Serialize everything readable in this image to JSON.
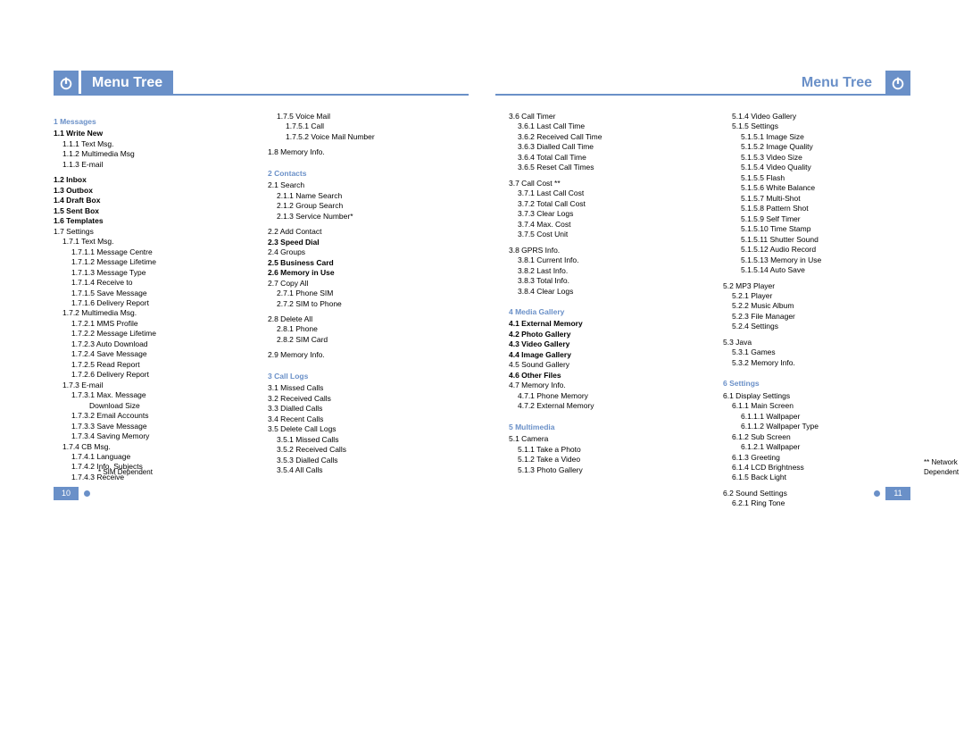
{
  "title": "Menu Tree",
  "page_left_num": "10",
  "page_right_num": "11",
  "footnote_left": "* SIM Dependent",
  "footnote_right": "** Network Dependent",
  "col1": [
    {
      "t": "1 Messages",
      "head": true
    },
    {
      "t": "1.1 Write New",
      "bold": true,
      "l": 1
    },
    {
      "t": "1.1.1 Text Msg.",
      "l": 2
    },
    {
      "t": "1.1.2 Multimedia Msg",
      "l": 2
    },
    {
      "t": "1.1.3 E-mail",
      "l": 2
    },
    {
      "sp": true
    },
    {
      "t": "1.2 Inbox",
      "bold": true,
      "l": 1
    },
    {
      "t": "1.3 Outbox",
      "bold": true,
      "l": 1
    },
    {
      "t": "1.4 Draft Box",
      "bold": true,
      "l": 1
    },
    {
      "t": "1.5 Sent Box",
      "bold": true,
      "l": 1
    },
    {
      "t": "1.6 Templates",
      "bold": true,
      "l": 1
    },
    {
      "t": "1.7 Settings",
      "l": 1
    },
    {
      "t": "1.7.1 Text Msg.",
      "l": 2
    },
    {
      "t": "1.7.1.1 Message Centre",
      "l": 3
    },
    {
      "t": "1.7.1.2 Message Lifetime",
      "l": 3
    },
    {
      "t": "1.7.1.3 Message Type",
      "l": 3
    },
    {
      "t": "1.7.1.4 Receive to",
      "l": 3
    },
    {
      "t": "1.7.1.5 Save Message",
      "l": 3
    },
    {
      "t": "1.7.1.6 Delivery Report",
      "l": 3
    },
    {
      "t": "1.7.2 Multimedia Msg.",
      "l": 2
    },
    {
      "t": "1.7.2.1 MMS Profile",
      "l": 3
    },
    {
      "t": "1.7.2.2 Message Lifetime",
      "l": 3
    },
    {
      "t": "1.7.2.3 Auto Download",
      "l": 3
    },
    {
      "t": "1.7.2.4 Save Message",
      "l": 3
    },
    {
      "t": "1.7.2.5 Read Report",
      "l": 3
    },
    {
      "t": "1.7.2.6 Delivery Report",
      "l": 3
    },
    {
      "t": "1.7.3 E-mail",
      "l": 2
    },
    {
      "t": "1.7.3.1 Max. Message",
      "l": 3
    },
    {
      "t": "Download Size",
      "l": 5
    },
    {
      "t": "1.7.3.2 Email Accounts",
      "l": 3
    },
    {
      "t": "1.7.3.3 Save Message",
      "l": 3
    },
    {
      "t": "1.7.3.4 Saving Memory",
      "l": 3
    },
    {
      "t": "1.7.4 CB Msg.",
      "l": 2
    },
    {
      "t": "1.7.4.1 Language",
      "l": 3
    },
    {
      "t": "1.7.4.2 Info. Subjects",
      "l": 3
    },
    {
      "t": "1.7.4.3 Receive",
      "l": 3
    }
  ],
  "col2": [
    {
      "t": "1.7.5 Voice Mail",
      "l": 2
    },
    {
      "t": "1.7.5.1 Call",
      "l": 3
    },
    {
      "t": "1.7.5.2 Voice Mail Number",
      "l": 3
    },
    {
      "sp": true
    },
    {
      "t": "1.8 Memory Info.",
      "l": 1
    },
    {
      "sp": true
    },
    {
      "t": "2 Contacts",
      "head": true
    },
    {
      "t": "2.1 Search",
      "l": 1
    },
    {
      "t": "2.1.1 Name Search",
      "l": 2
    },
    {
      "t": "2.1.2 Group Search",
      "l": 2
    },
    {
      "t": "2.1.3 Service Number*",
      "l": 2
    },
    {
      "sp": true
    },
    {
      "t": "2.2 Add Contact",
      "l": 1
    },
    {
      "t": "2.3 Speed Dial",
      "bold": true,
      "l": 1
    },
    {
      "t": "2.4 Groups",
      "l": 1
    },
    {
      "t": "2.5 Business Card",
      "bold": true,
      "l": 1
    },
    {
      "t": "2.6 Memory in Use",
      "bold": true,
      "l": 1
    },
    {
      "t": "2.7 Copy All",
      "l": 1
    },
    {
      "t": "2.7.1 Phone SIM",
      "l": 2
    },
    {
      "t": "2.7.2 SIM to Phone",
      "l": 2
    },
    {
      "sp": true
    },
    {
      "t": "2.8 Delete All",
      "l": 1
    },
    {
      "t": "2.8.1 Phone",
      "l": 2
    },
    {
      "t": "2.8.2 SIM Card",
      "l": 2
    },
    {
      "sp": true
    },
    {
      "t": "2.9 Memory Info.",
      "l": 1
    },
    {
      "sp": true
    },
    {
      "t": "3 Call Logs",
      "head": true
    },
    {
      "t": "3.1 Missed Calls",
      "l": 1
    },
    {
      "t": "3.2 Received Calls",
      "l": 1
    },
    {
      "t": "3.3 Dialled Calls",
      "l": 1
    },
    {
      "t": "3.4 Recent Calls",
      "l": 1
    },
    {
      "t": "3.5 Delete Call Logs",
      "l": 1
    },
    {
      "t": "3.5.1 Missed Calls",
      "l": 2
    },
    {
      "t": "3.5.2 Received Calls",
      "l": 2
    },
    {
      "t": "3.5.3 Dialled Calls",
      "l": 2
    },
    {
      "t": "3.5.4 All Calls",
      "l": 2
    }
  ],
  "col3": [
    {
      "t": "3.6 Call Timer",
      "l": 1
    },
    {
      "t": "3.6.1 Last Call Time",
      "l": 2
    },
    {
      "t": "3.6.2 Received Call Time",
      "l": 2
    },
    {
      "t": "3.6.3 Dialled Call Time",
      "l": 2
    },
    {
      "t": "3.6.4 Total Call Time",
      "l": 2
    },
    {
      "t": "3.6.5 Reset Call Times",
      "l": 2
    },
    {
      "sp": true
    },
    {
      "t": "3.7 Call Cost **",
      "l": 1
    },
    {
      "t": "3.7.1 Last Call Cost",
      "l": 2
    },
    {
      "t": "3.7.2 Total Call Cost",
      "l": 2
    },
    {
      "t": "3.7.3 Clear Logs",
      "l": 2
    },
    {
      "t": "3.7.4 Max. Cost",
      "l": 2
    },
    {
      "t": "3.7.5 Cost Unit",
      "l": 2
    },
    {
      "sp": true
    },
    {
      "t": "3.8 GPRS Info.",
      "l": 1
    },
    {
      "t": "3.8.1 Current Info.",
      "l": 2
    },
    {
      "t": "3.8.2 Last Info.",
      "l": 2
    },
    {
      "t": "3.8.3 Total Info.",
      "l": 2
    },
    {
      "t": "3.8.4 Clear Logs",
      "l": 2
    },
    {
      "sp": true
    },
    {
      "t": "4 Media Gallery",
      "head": true
    },
    {
      "t": "4.1 External Memory",
      "bold": true,
      "l": 1
    },
    {
      "t": "4.2 Photo Gallery",
      "bold": true,
      "l": 1
    },
    {
      "t": "4.3 Video Gallery",
      "bold": true,
      "l": 1
    },
    {
      "t": "4.4 Image Gallery",
      "bold": true,
      "l": 1
    },
    {
      "t": "4.5 Sound Gallery",
      "l": 1
    },
    {
      "t": "4.6 Other Files",
      "bold": true,
      "l": 1
    },
    {
      "t": "4.7 Memory Info.",
      "l": 1
    },
    {
      "t": "4.7.1 Phone Memory",
      "l": 2
    },
    {
      "t": "4.7.2 External Memory",
      "l": 2
    },
    {
      "sp": true
    },
    {
      "t": "5 Multimedia",
      "head": true
    },
    {
      "t": "5.1 Camera",
      "l": 1
    },
    {
      "t": "5.1.1 Take a Photo",
      "l": 2
    },
    {
      "t": "5.1.2 Take a Video",
      "l": 2
    },
    {
      "t": "5.1.3 Photo Gallery",
      "l": 2
    }
  ],
  "col4": [
    {
      "t": "5.1.4 Video Gallery",
      "l": 2
    },
    {
      "t": "5.1.5 Settings",
      "l": 2
    },
    {
      "t": "5.1.5.1 Image Size",
      "l": 3
    },
    {
      "t": "5.1.5.2 Image Quality",
      "l": 3
    },
    {
      "t": "5.1.5.3 Video Size",
      "l": 3
    },
    {
      "t": "5.1.5.4 Video Quality",
      "l": 3
    },
    {
      "t": "5.1.5.5 Flash",
      "l": 3
    },
    {
      "t": "5.1.5.6 White Balance",
      "l": 3
    },
    {
      "t": "5.1.5.7 Multi-Shot",
      "l": 3
    },
    {
      "t": "5.1.5.8 Pattern Shot",
      "l": 3
    },
    {
      "t": "5.1.5.9 Self Timer",
      "l": 3
    },
    {
      "t": "5.1.5.10 Time Stamp",
      "l": 3
    },
    {
      "t": "5.1.5.11 Shutter Sound",
      "l": 3
    },
    {
      "t": "5.1.5.12 Audio Record",
      "l": 3
    },
    {
      "t": "5.1.5.13 Memory in Use",
      "l": 3
    },
    {
      "t": "5.1.5.14 Auto Save",
      "l": 3
    },
    {
      "sp": true
    },
    {
      "t": "5.2 MP3 Player",
      "l": 1
    },
    {
      "t": "5.2.1 Player",
      "l": 2
    },
    {
      "t": "5.2.2 Music Album",
      "l": 2
    },
    {
      "t": "5.2.3 File Manager",
      "l": 2
    },
    {
      "t": "5.2.4 Settings",
      "l": 2
    },
    {
      "sp": true
    },
    {
      "t": "5.3 Java",
      "l": 1
    },
    {
      "t": "5.3.1 Games",
      "l": 2
    },
    {
      "t": "5.3.2 Memory Info.",
      "l": 2
    },
    {
      "sp": true
    },
    {
      "t": "6 Settings",
      "head": true
    },
    {
      "t": "6.1 Display Settings",
      "l": 1
    },
    {
      "t": "6.1.1 Main Screen",
      "l": 2
    },
    {
      "t": "6.1.1.1 Wallpaper",
      "l": 3
    },
    {
      "t": "6.1.1.2 Wallpaper Type",
      "l": 3
    },
    {
      "t": "6.1.2 Sub Screen",
      "l": 2
    },
    {
      "t": "6.1.2.1 Wallpaper",
      "l": 3
    },
    {
      "t": "6.1.3 Greeting",
      "l": 2
    },
    {
      "t": "6.1.4 LCD Brightness",
      "l": 2
    },
    {
      "t": "6.1.5 Back Light",
      "l": 2
    },
    {
      "sp": true
    },
    {
      "t": "6.2 Sound Settings",
      "l": 1
    },
    {
      "t": "6.2.1 Ring Tone",
      "l": 2
    }
  ]
}
